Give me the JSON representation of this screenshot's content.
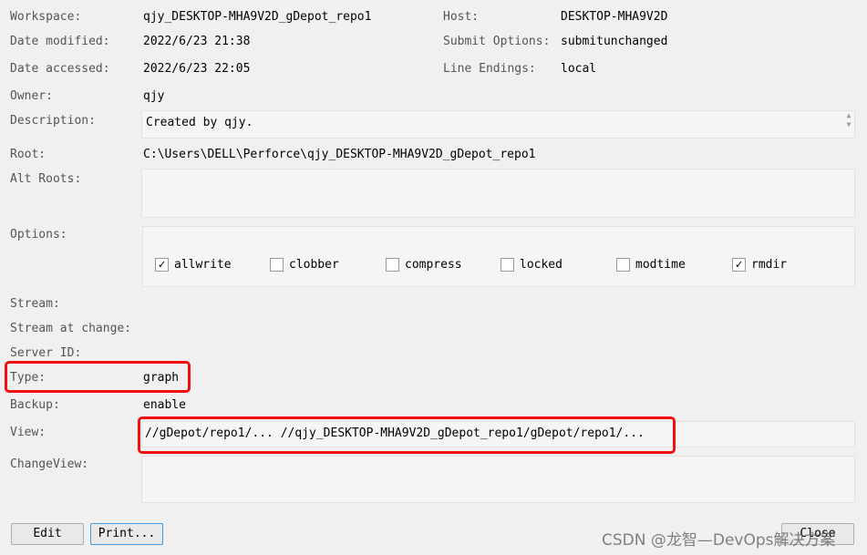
{
  "fields": {
    "workspace": {
      "label": "Workspace:",
      "value": "qjy_DESKTOP-MHA9V2D_gDepot_repo1"
    },
    "date_modified": {
      "label": "Date modified:",
      "value": "2022/6/23 21:38"
    },
    "date_accessed": {
      "label": "Date accessed:",
      "value": "2022/6/23 22:05"
    },
    "owner": {
      "label": "Owner:",
      "value": "qjy"
    },
    "description": {
      "label": "Description:",
      "value": "Created by qjy."
    },
    "root": {
      "label": "Root:",
      "value": "C:\\Users\\DELL\\Perforce\\qjy_DESKTOP-MHA9V2D_gDepot_repo1"
    },
    "alt_roots": {
      "label": "Alt Roots:",
      "value": ""
    },
    "options": {
      "label": "Options:"
    },
    "stream": {
      "label": "Stream:",
      "value": ""
    },
    "stream_at_change": {
      "label": "Stream at change:",
      "value": ""
    },
    "server_id": {
      "label": "Server ID:",
      "value": ""
    },
    "type": {
      "label": "Type:",
      "value": "graph"
    },
    "backup": {
      "label": "Backup:",
      "value": "enable"
    },
    "view": {
      "label": "View:",
      "value": "//gDepot/repo1/... //qjy_DESKTOP-MHA9V2D_gDepot_repo1/gDepot/repo1/..."
    },
    "change_view": {
      "label": "ChangeView:",
      "value": ""
    },
    "host": {
      "label": "Host:",
      "value": "DESKTOP-MHA9V2D"
    },
    "submit_options": {
      "label": "Submit Options:",
      "value": "submitunchanged"
    },
    "line_endings": {
      "label": "Line Endings:",
      "value": "local"
    }
  },
  "options": [
    {
      "label": "allwrite",
      "checked": true
    },
    {
      "label": "clobber",
      "checked": false
    },
    {
      "label": "compress",
      "checked": false
    },
    {
      "label": "locked",
      "checked": false
    },
    {
      "label": "modtime",
      "checked": false
    },
    {
      "label": "rmdir",
      "checked": true
    }
  ],
  "buttons": {
    "edit": "Edit",
    "print": "Print...",
    "close": "Close"
  },
  "watermark": "CSDN @龙智—DevOps解决方案",
  "highlight_color": "#f01010"
}
